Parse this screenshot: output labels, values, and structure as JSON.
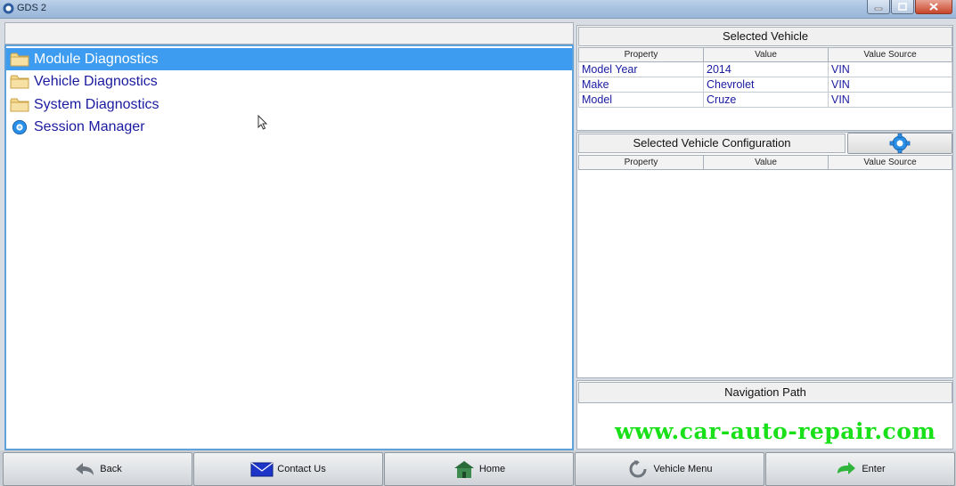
{
  "window": {
    "title": "GDS 2"
  },
  "tree": {
    "items": [
      {
        "label": "Module Diagnostics",
        "icon": "folder-icon",
        "selected": true
      },
      {
        "label": "Vehicle Diagnostics",
        "icon": "folder-icon",
        "selected": false
      },
      {
        "label": "System Diagnostics",
        "icon": "folder-icon",
        "selected": false
      },
      {
        "label": "Session Manager",
        "icon": "gear-icon",
        "selected": false
      }
    ]
  },
  "selected_vehicle": {
    "title": "Selected Vehicle",
    "columns": [
      "Property",
      "Value",
      "Value Source"
    ],
    "rows": [
      {
        "property": "Model Year",
        "value": "2014",
        "source": "VIN"
      },
      {
        "property": "Make",
        "value": "Chevrolet",
        "source": "VIN"
      },
      {
        "property": "Model",
        "value": "Cruze",
        "source": "VIN"
      }
    ]
  },
  "vehicle_config": {
    "title": "Selected Vehicle Configuration",
    "columns": [
      "Property",
      "Value",
      "Value Source"
    ]
  },
  "navigation_path": {
    "title": "Navigation Path"
  },
  "watermark": "www.car-auto-repair.com",
  "toolbar": {
    "back": "Back",
    "contact": "Contact Us",
    "home": "Home",
    "vehicle_menu": "Vehicle Menu",
    "enter": "Enter"
  },
  "colors": {
    "selection": "#3d9cf0",
    "link_text": "#1a1aa0",
    "watermark": "#19e019"
  }
}
